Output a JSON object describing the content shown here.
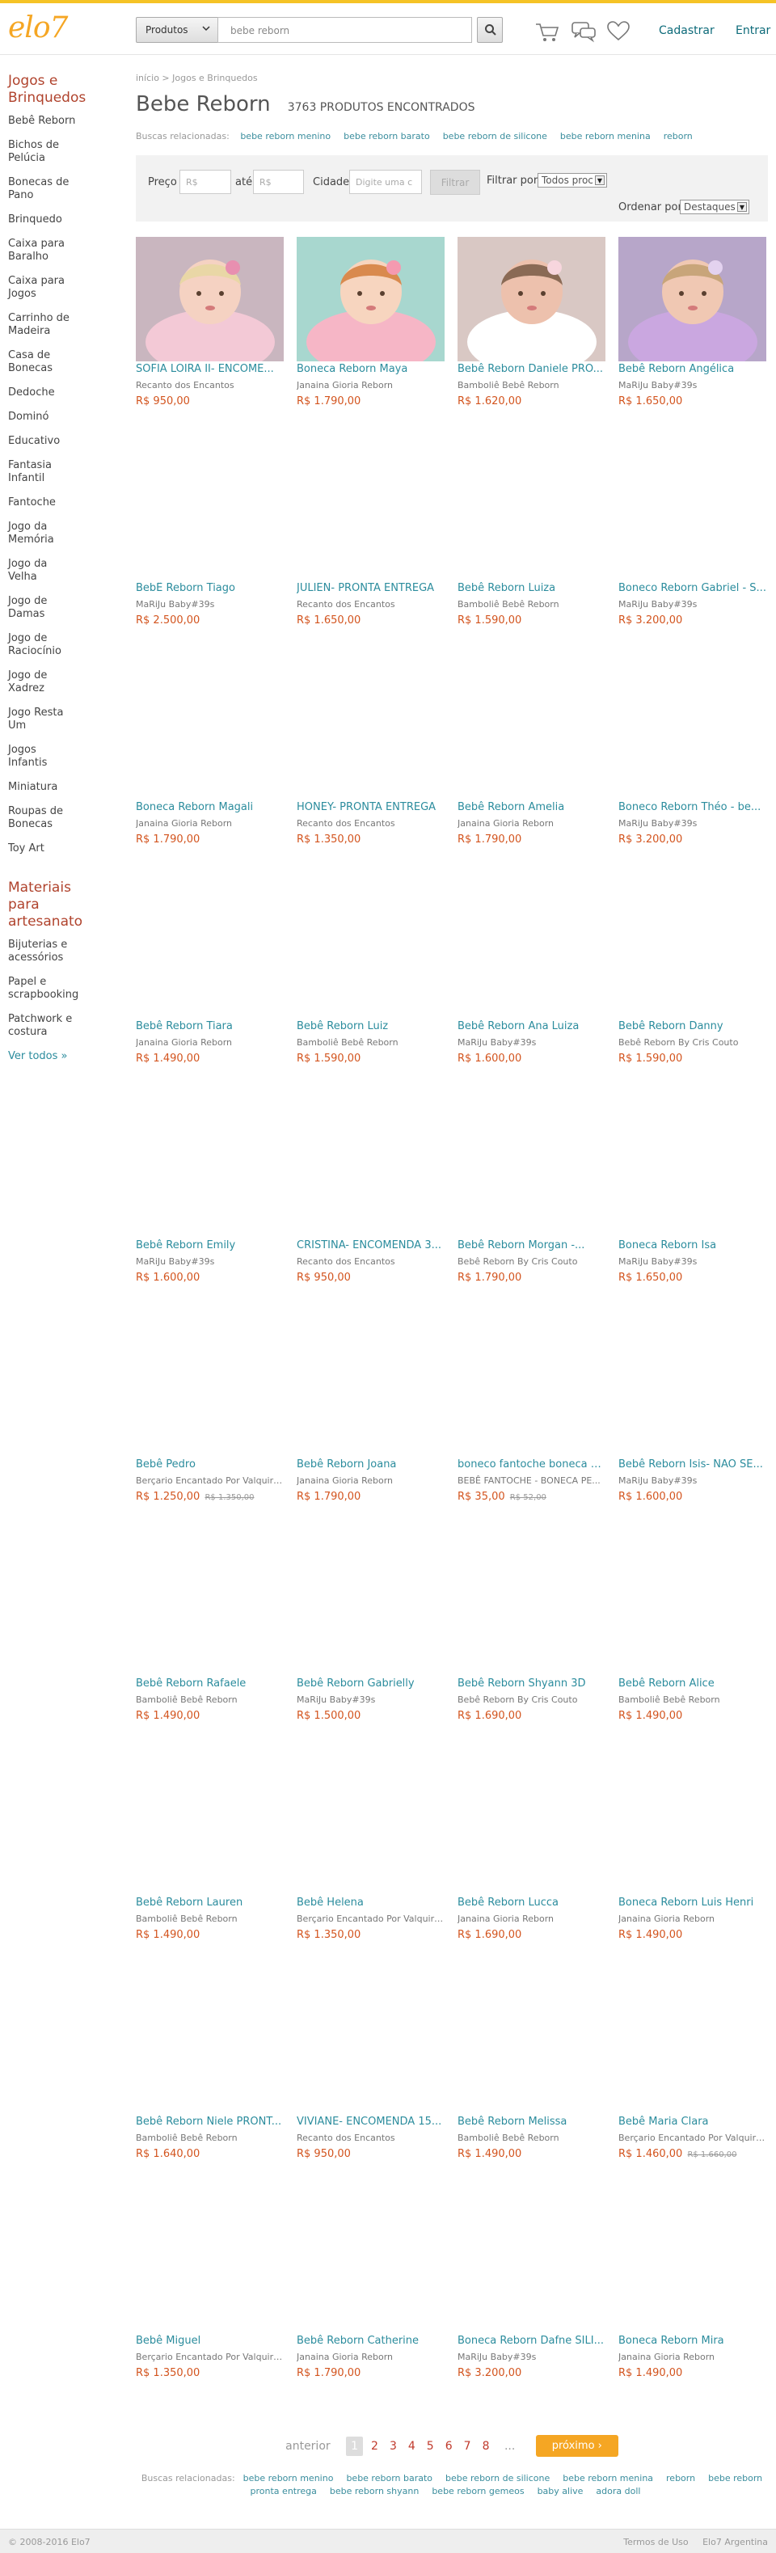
{
  "header": {
    "logo": "elo7",
    "search_scope": "Produtos",
    "search_value": "bebe reborn",
    "register": "Cadastrar",
    "login": "Entrar"
  },
  "sidebar": {
    "section1_title": "Jogos e Brinquedos",
    "section1_items": [
      "Bebê Reborn",
      "Bichos de Pelúcia",
      "Bonecas de Pano",
      "Brinquedo",
      "Caixa para Baralho",
      "Caixa para Jogos",
      "Carrinho de Madeira",
      "Casa de Bonecas",
      "Dedoche",
      "Dominó",
      "Educativo",
      "Fantasia Infantil",
      "Fantoche",
      "Jogo da Memória",
      "Jogo da Velha",
      "Jogo de Damas",
      "Jogo de Raciocínio",
      "Jogo de Xadrez",
      "Jogo Resta Um",
      "Jogos Infantis",
      "Miniatura",
      "Roupas de Bonecas",
      "Toy Art"
    ],
    "section2_title": "Materiais para artesanato",
    "section2_items": [
      "Bijuterias e acessórios",
      "Papel e scrapbooking",
      "Patchwork e costura"
    ],
    "see_all": "Ver todos »"
  },
  "breadcrumb": "início > Jogos e Brinquedos",
  "page_title": "Bebe Reborn",
  "result_count": "3763 PRODUTOS ENCONTRADOS",
  "related_label": "Buscas relacionadas:",
  "related_top": [
    "bebe reborn menino",
    "bebe reborn barato",
    "bebe reborn de silicone",
    "bebe reborn menina",
    "reborn"
  ],
  "filters": {
    "price_label": "Preço",
    "price_min_placeholder": "R$",
    "until_label": "até",
    "price_max_placeholder": "R$",
    "city_label": "Cidade",
    "city_placeholder": "Digite uma c",
    "filter_button": "Filtrar",
    "filter_by_label": "Filtrar por",
    "filter_by_value": "Todos proc",
    "order_by_label": "Ordenar por",
    "order_by_value": "Destaques"
  },
  "products": [
    {
      "name": "SOFIA LOIRA II- ENCOME...",
      "shop": "Recanto dos Encantos",
      "price": "R$ 950,00",
      "old_price": ""
    },
    {
      "name": "Boneca Reborn Maya",
      "shop": "Janaina Gioria Reborn",
      "price": "R$ 1.790,00",
      "old_price": ""
    },
    {
      "name": "Bebê Reborn Daniele PRO...",
      "shop": "Bamboliê Bebê Reborn",
      "price": "R$ 1.620,00",
      "old_price": ""
    },
    {
      "name": "Bebê Reborn Angélica",
      "shop": "MaRiJu Baby#39s",
      "price": "R$ 1.650,00",
      "old_price": ""
    },
    {
      "name": "BebÊ Reborn Tiago",
      "shop": "MaRiJu Baby#39s",
      "price": "R$ 2.500,00",
      "old_price": ""
    },
    {
      "name": "JULIEN- PRONTA ENTREGA",
      "shop": "Recanto dos Encantos",
      "price": "R$ 1.650,00",
      "old_price": ""
    },
    {
      "name": "Bebê Reborn Luiza",
      "shop": "Bamboliê Bebê Reborn",
      "price": "R$ 1.590,00",
      "old_price": ""
    },
    {
      "name": "Boneco Reborn Gabriel - S...",
      "shop": "MaRiJu Baby#39s",
      "price": "R$ 3.200,00",
      "old_price": ""
    },
    {
      "name": "Boneca Reborn Magali",
      "shop": "Janaina Gioria Reborn",
      "price": "R$ 1.790,00",
      "old_price": ""
    },
    {
      "name": "HONEY- PRONTA ENTREGA",
      "shop": "Recanto dos Encantos",
      "price": "R$ 1.350,00",
      "old_price": ""
    },
    {
      "name": "Bebê Reborn Amelia",
      "shop": "Janaina Gioria Reborn",
      "price": "R$ 1.790,00",
      "old_price": ""
    },
    {
      "name": "Boneco Reborn Théo - be...",
      "shop": "MaRiJu Baby#39s",
      "price": "R$ 3.200,00",
      "old_price": ""
    },
    {
      "name": "Bebê Reborn Tiara",
      "shop": "Janaina Gioria Reborn",
      "price": "R$ 1.490,00",
      "old_price": ""
    },
    {
      "name": "Bebê Reborn Luiz",
      "shop": "Bamboliê Bebê Reborn",
      "price": "R$ 1.590,00",
      "old_price": ""
    },
    {
      "name": "Bebê Reborn Ana Luiza",
      "shop": "MaRiJu Baby#39s",
      "price": "R$ 1.600,00",
      "old_price": ""
    },
    {
      "name": "Bebê Reborn Danny",
      "shop": "Bebê Reborn By Cris Couto",
      "price": "R$ 1.590,00",
      "old_price": ""
    },
    {
      "name": "Bebê Reborn Emily",
      "shop": "MaRiJu Baby#39s",
      "price": "R$ 1.600,00",
      "old_price": ""
    },
    {
      "name": "CRISTINA- ENCOMENDA 3...",
      "shop": "Recanto dos Encantos",
      "price": "R$ 950,00",
      "old_price": ""
    },
    {
      "name": "Bebê Reborn Morgan -...",
      "shop": "Bebê Reborn By Cris Couto",
      "price": "R$ 1.790,00",
      "old_price": ""
    },
    {
      "name": "Boneca Reborn Isa",
      "shop": "MaRiJu Baby#39s",
      "price": "R$ 1.650,00",
      "old_price": ""
    },
    {
      "name": "Bebê Pedro",
      "shop": "Berçario Encantado Por Valquiri...",
      "price": "R$ 1.250,00",
      "old_price": "R$ 1.350,00"
    },
    {
      "name": "Bebê Reborn Joana",
      "shop": "Janaina Gioria Reborn",
      "price": "R$ 1.790,00",
      "old_price": ""
    },
    {
      "name": "boneco fantoche boneca p...",
      "shop": "BEBÊ FANTOCHE - BONECA PE...",
      "price": "R$ 35,00",
      "old_price": "R$ 52,00"
    },
    {
      "name": "Bebê Reborn Isis- NÃO SE...",
      "shop": "MaRiJu Baby#39s",
      "price": "R$ 1.600,00",
      "old_price": ""
    },
    {
      "name": "Bebê Reborn Rafaele",
      "shop": "Bamboliê Bebê Reborn",
      "price": "R$ 1.490,00",
      "old_price": ""
    },
    {
      "name": "Bebê Reborn Gabrielly",
      "shop": "MaRiJu Baby#39s",
      "price": "R$ 1.500,00",
      "old_price": ""
    },
    {
      "name": "Bebê Reborn Shyann 3D",
      "shop": "Bebê Reborn By Cris Couto",
      "price": "R$ 1.690,00",
      "old_price": ""
    },
    {
      "name": "Bebê Reborn Alice",
      "shop": "Bamboliê Bebê Reborn",
      "price": "R$ 1.490,00",
      "old_price": ""
    },
    {
      "name": "Bebê Reborn Lauren",
      "shop": "Bamboliê Bebê Reborn",
      "price": "R$ 1.490,00",
      "old_price": ""
    },
    {
      "name": "Bebê Helena",
      "shop": "Berçario Encantado Por Valquiri...",
      "price": "R$ 1.350,00",
      "old_price": ""
    },
    {
      "name": "Bebê Reborn Lucca",
      "shop": "Janaina Gioria Reborn",
      "price": "R$ 1.690,00",
      "old_price": ""
    },
    {
      "name": "Boneca Reborn Luis Henri",
      "shop": "Janaina Gioria Reborn",
      "price": "R$ 1.490,00",
      "old_price": ""
    },
    {
      "name": "Bebê Reborn Niele PRONT...",
      "shop": "Bamboliê Bebê Reborn",
      "price": "R$ 1.640,00",
      "old_price": ""
    },
    {
      "name": "VIVIANE- ENCOMENDA 15...",
      "shop": "Recanto dos Encantos",
      "price": "R$ 950,00",
      "old_price": ""
    },
    {
      "name": "Bebê Reborn Melissa",
      "shop": "Bamboliê Bebê Reborn",
      "price": "R$ 1.490,00",
      "old_price": ""
    },
    {
      "name": "Bebê Maria Clara",
      "shop": "Berçario Encantado Por Valquiri...",
      "price": "R$ 1.460,00",
      "old_price": "R$ 1.660,00"
    },
    {
      "name": "Bebê Miguel",
      "shop": "Berçario Encantado Por Valquiri...",
      "price": "R$ 1.350,00",
      "old_price": ""
    },
    {
      "name": "Bebê Reborn Catherine",
      "shop": "Janaina Gioria Reborn",
      "price": "R$ 1.790,00",
      "old_price": ""
    },
    {
      "name": "Boneca Reborn Dafne SILI...",
      "shop": "MaRiJu Baby#39s",
      "price": "R$ 3.200,00",
      "old_price": ""
    },
    {
      "name": "Boneca Reborn Mira",
      "shop": "Janaina Gioria Reborn",
      "price": "R$ 1.490,00",
      "old_price": ""
    }
  ],
  "pagination": {
    "prev": "anterior",
    "pages": [
      "1",
      "2",
      "3",
      "4",
      "5",
      "6",
      "7",
      "8"
    ],
    "current": "1",
    "dots": "...",
    "next": "próximo ›"
  },
  "related_bottom": [
    "bebe reborn menino",
    "bebe reborn barato",
    "bebe reborn de silicone",
    "bebe reborn menina",
    "reborn",
    "bebe reborn pronta entrega",
    "bebe reborn shyann",
    "bebe reborn gemeos",
    "baby alive",
    "adora doll"
  ],
  "footer": {
    "copyright": "© 2008-2016 Elo7",
    "links": [
      "Termos de Uso",
      "Elo7 Argentina"
    ]
  },
  "colors": {
    "brand": "#f5a623",
    "link": "#2b8c9d",
    "price": "#d3541e",
    "category_title": "#b0432d"
  },
  "icons": [
    "chevron-down-icon",
    "search-icon",
    "cart-icon",
    "chat-icon",
    "heart-icon",
    "arrow-down-icon"
  ]
}
